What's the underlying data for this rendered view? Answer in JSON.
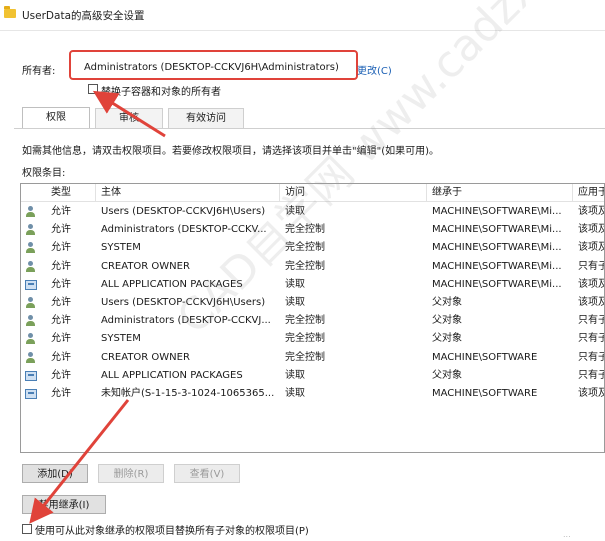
{
  "window": {
    "title": "UserData的高级安全设置"
  },
  "owner": {
    "label": "所有者:",
    "value": "Administrators (DESKTOP-CCKVJ6H\\Administrators)",
    "change_link": "更改(C)",
    "replace_checkbox_label": "替换子容器和对象的所有者",
    "replace_checked": false
  },
  "tabs": [
    {
      "label": "权限",
      "active": true
    },
    {
      "label": "审核",
      "active": false
    },
    {
      "label": "有效访问",
      "active": false
    }
  ],
  "instructions": "如需其他信息，请双击权限项目。若要修改权限项目，请选择该项目并单击\"编辑\"(如果可用)。",
  "entries_label": "权限条目:",
  "columns": [
    "类型",
    "主体",
    "访问",
    "继承于",
    "应用于"
  ],
  "entries": [
    {
      "icon": "user-group-icon",
      "type": "允许",
      "principal": "Users (DESKTOP-CCKVJ6H\\Users)",
      "access": "读取",
      "inherited": "MACHINE\\SOFTWARE\\Mi...",
      "applies": "该项及"
    },
    {
      "icon": "user-group-icon",
      "type": "允许",
      "principal": "Administrators (DESKTOP-CCKV...",
      "access": "完全控制",
      "inherited": "MACHINE\\SOFTWARE\\Mi...",
      "applies": "该项及"
    },
    {
      "icon": "user-group-icon",
      "type": "允许",
      "principal": "SYSTEM",
      "access": "完全控制",
      "inherited": "MACHINE\\SOFTWARE\\Mi...",
      "applies": "该项及"
    },
    {
      "icon": "user-group-icon",
      "type": "允许",
      "principal": "CREATOR OWNER",
      "access": "完全控制",
      "inherited": "MACHINE\\SOFTWARE\\Mi...",
      "applies": "只有子"
    },
    {
      "icon": "package-icon",
      "type": "允许",
      "principal": "ALL APPLICATION PACKAGES",
      "access": "读取",
      "inherited": "MACHINE\\SOFTWARE\\Mi...",
      "applies": "该项及"
    },
    {
      "icon": "user-group-icon",
      "type": "允许",
      "principal": "Users (DESKTOP-CCKVJ6H\\Users)",
      "access": "读取",
      "inherited": "父对象",
      "applies": "该项及"
    },
    {
      "icon": "user-group-icon",
      "type": "允许",
      "principal": "Administrators (DESKTOP-CCKVJ...",
      "access": "完全控制",
      "inherited": "父对象",
      "applies": "只有子"
    },
    {
      "icon": "user-group-icon",
      "type": "允许",
      "principal": "SYSTEM",
      "access": "完全控制",
      "inherited": "父对象",
      "applies": "只有子"
    },
    {
      "icon": "user-group-icon",
      "type": "允许",
      "principal": "CREATOR OWNER",
      "access": "完全控制",
      "inherited": "MACHINE\\SOFTWARE",
      "applies": "只有子"
    },
    {
      "icon": "package-icon",
      "type": "允许",
      "principal": "ALL APPLICATION PACKAGES",
      "access": "读取",
      "inherited": "父对象",
      "applies": "只有子"
    },
    {
      "icon": "package-icon",
      "type": "允许",
      "principal": "未知帐户(S-1-15-3-1024-1065365...",
      "access": "读取",
      "inherited": "MACHINE\\SOFTWARE",
      "applies": "该项及"
    }
  ],
  "buttons": {
    "add": "添加(D)",
    "remove": "删除(R)",
    "view": "查看(V)",
    "disable_inheritance": "禁用继承(I)"
  },
  "replace_permissions_label": "使用可从此对象继承的权限项目替换所有子对象的权限项目(P)",
  "replace_permissions_checked": false,
  "watermark": "CAD自学网 www.cadzxw.com",
  "corner_mark": "...",
  "colors": {
    "annotation": "#e0433a",
    "link": "#1a5fb4"
  }
}
